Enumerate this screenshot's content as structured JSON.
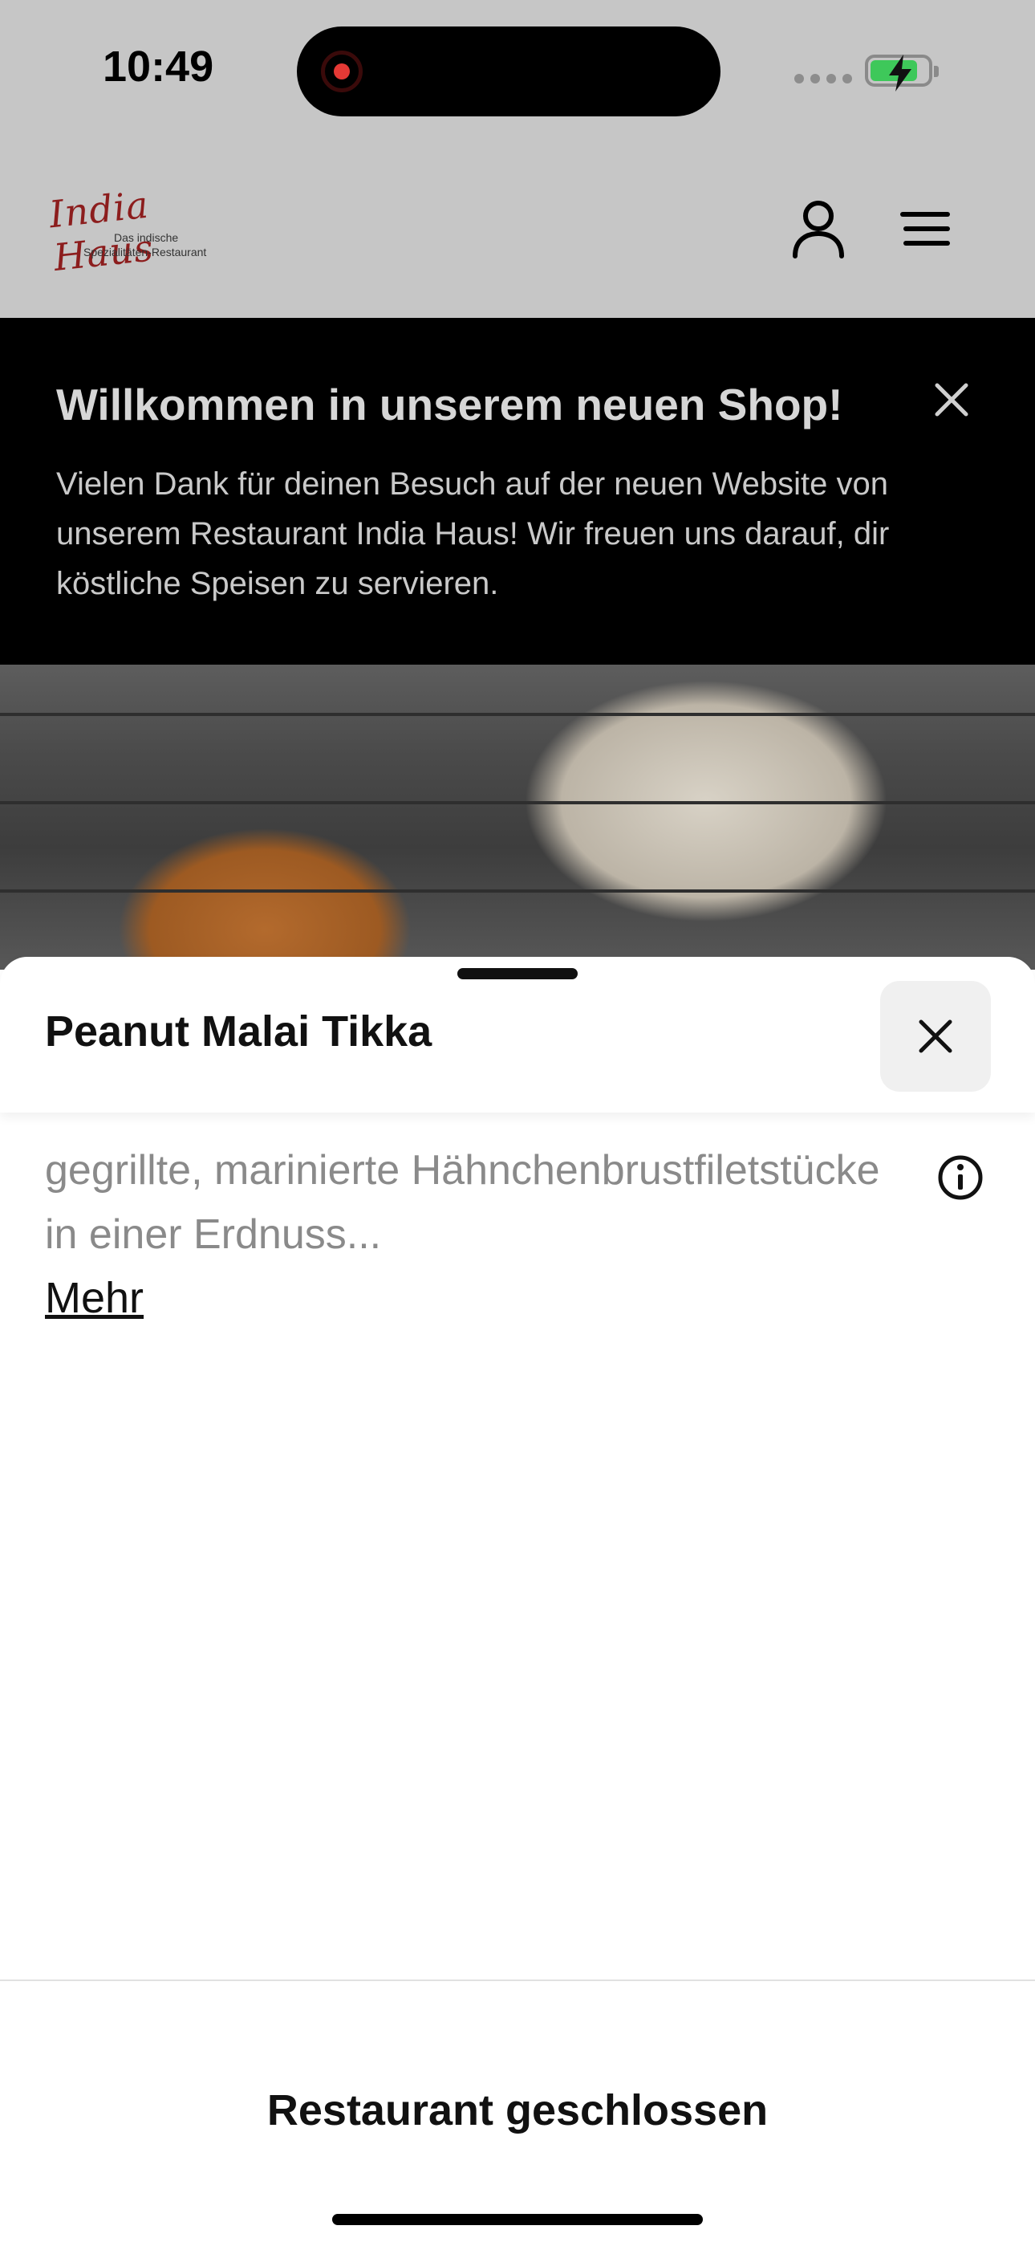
{
  "status_bar": {
    "time": "10:49"
  },
  "header": {
    "logo_name": "India Haus",
    "logo_tagline_1": "Das indische",
    "logo_tagline_2": "Spezialitäten-Restaurant",
    "account_icon": "person-icon",
    "menu_icon": "hamburger-menu-icon"
  },
  "banner": {
    "title": "Willkommen in unserem neuen Shop!",
    "text": "Vielen Dank für deinen Besuch auf der neuen Website von unserem Restaurant India Haus! Wir freuen uns darauf, dir köstliche Speisen zu servieren."
  },
  "sheet": {
    "title": "Peanut Malai Tikka",
    "description": "gegrillte, marinierte Hähnchenbrustfiletstücke in einer Erdnuss...",
    "more_label": "Mehr",
    "info_icon": "info-icon",
    "close_icon": "close-icon"
  },
  "footer": {
    "status": "Restaurant geschlossen"
  },
  "colors": {
    "logo_red": "#8c1d1d",
    "battery_green": "#3ec85a",
    "banner_bg": "#000000"
  }
}
